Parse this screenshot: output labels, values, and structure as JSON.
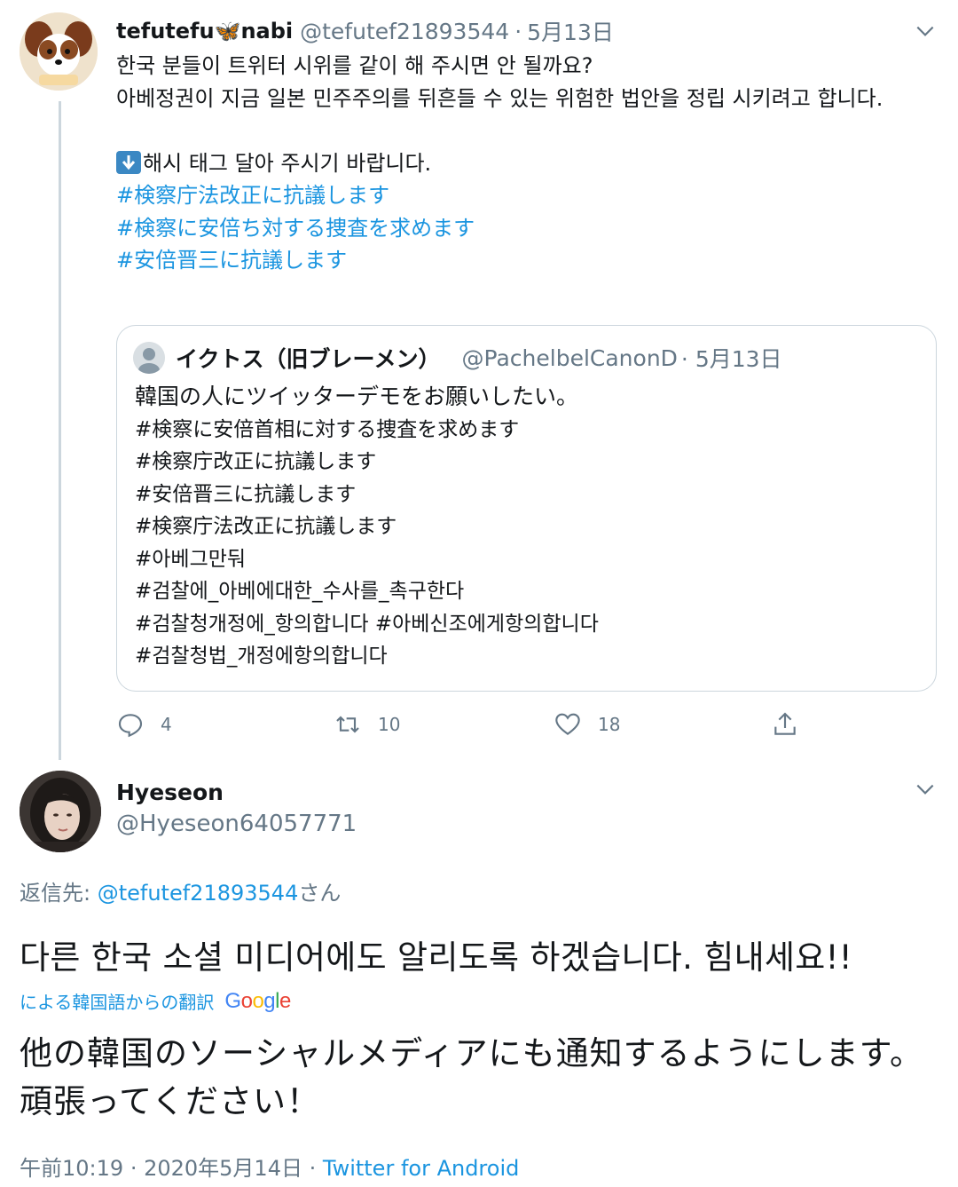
{
  "tweet1": {
    "author_name": "tefutefu🦋nabi",
    "author_handle": "@tefutef21893544",
    "separator": "·",
    "date": "5月13日",
    "body_lines": [
      "한국 분들이 트위터 시위를 같이 해 주시면 안 될까요?",
      "아베정권이 지금 일본 민주주의를 뒤흔들 수 있는 위험한 법안을 정립 시키려고 합니다."
    ],
    "hashtag_intro": "해시 태그 달아 주시기 바랍니다.",
    "hashtags": [
      "#検察庁法改正に抗議します",
      "#検察に安倍ち対する捜査を求めます",
      "#安倍晋三に抗議します"
    ],
    "quoted": {
      "author_name": "イクトス（旧ブレーメン）",
      "author_handle": "@PachelbelCanonD",
      "date": "· 5月13日",
      "lines": [
        "韓国の人にツイッターデモをお願いしたい。",
        "#検察に安倍首相に対する捜査を求めます",
        "#検察庁改正に抗議します",
        "#安倍晋三に抗議します",
        "#検察庁法改正に抗議します",
        "#아베그만둬",
        "#검찰에_아베에대한_수사를_촉구한다",
        "#검찰청개정에_항의합니다 #아베신조에게항의합니다",
        "#검찰청법_개정에항의합니다"
      ]
    },
    "actions": {
      "replies": "4",
      "retweets": "10",
      "likes": "18"
    }
  },
  "tweet2": {
    "author_name": "Hyeseon",
    "author_handle": "@Hyeseon64057771",
    "replying_prefix": "返信先: ",
    "replying_to": "@tefutef21893544",
    "replying_suffix": "さん",
    "text": "다른 한국 소셜 미디어에도 알리도록 하겠습니다. 힘내세요!!",
    "translated_label": "による韓国語からの翻訳",
    "translation_provider": "Google",
    "translation": "他の韓国のソーシャルメディアにも通知するようにします。頑張ってください！",
    "time": "午前10:19",
    "date": "2020年5月14日",
    "via": "Twitter for Android"
  },
  "colors": {
    "link": "#1b95e0",
    "secondary_text": "#657786",
    "border": "#ccd6dd",
    "primary_text": "#14171a"
  },
  "icons": [
    "chevron-down-icon",
    "reply-icon",
    "retweet-icon",
    "like-icon",
    "share-icon",
    "down-arrow-emoji-icon",
    "butterfly-emoji-icon"
  ]
}
